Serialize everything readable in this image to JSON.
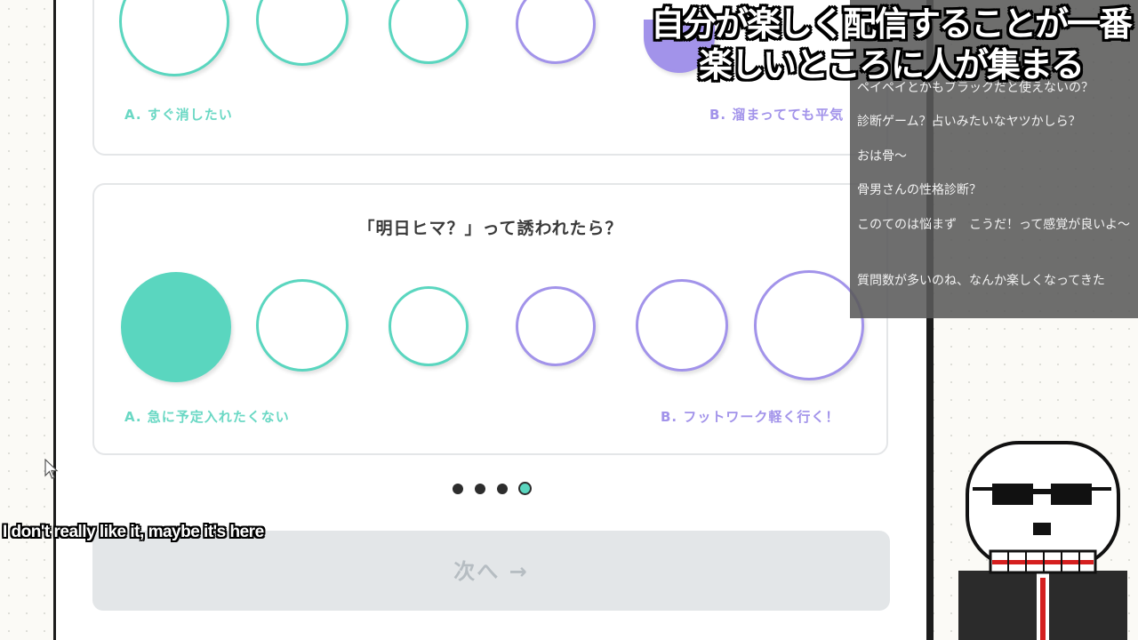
{
  "caption": {
    "line1": "自分が楽しく配信することが一番",
    "line2": "楽しいところに人が集まる"
  },
  "question_top": {
    "label_a": "A. すぐ消したい",
    "label_b": "B. 溜まってても平気"
  },
  "question_bottom": {
    "text": "「明日ヒマ？」って誘われたら？",
    "label_a": "A. 急に予定入れたくない",
    "label_b": "B. フットワーク軽く行く！",
    "selected_option": 1
  },
  "pagination": {
    "total": 4,
    "current": 4
  },
  "next_button": {
    "label": "次へ →"
  },
  "subtitle": {
    "text": "I don't really like it, maybe it's here"
  },
  "chat": {
    "messages": [
      "ペイペイとかもブラックだと使えないの？",
      "診断ゲーム？占いみたいなヤツかしら？",
      "おは骨～",
      "骨男さんの性格診断？",
      "このてのは悩まず　こうだ！って感覚が良いよ～",
      "質問数が多いのね、なんか楽しくなってきた"
    ]
  },
  "colors": {
    "option_a": "#5ad6bf",
    "option_b": "#a293ea",
    "chat_bg": "#5a5a5a"
  }
}
